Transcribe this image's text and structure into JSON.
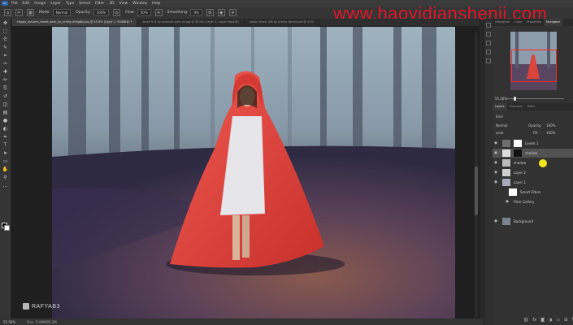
{
  "app": {
    "icon_label": "Ps"
  },
  "menubar": {
    "items": [
      "File",
      "Edit",
      "Image",
      "Layer",
      "Type",
      "Select",
      "Filter",
      "3D",
      "View",
      "Window",
      "Help"
    ]
  },
  "options": {
    "mode_label": "Mode:",
    "mode_value": "Normal",
    "opacity_label": "Opacity:",
    "opacity_value": "100%",
    "flow_label": "Flow:",
    "flow_value": "50%",
    "smoothing_label": "Smoothing:",
    "smoothing_value": "0%"
  },
  "watermark": "www.haoyidianshenji.com",
  "doc_tabs": [
    {
      "label": "Happy_autumn_forest_dark_by_schiko-d9ag6jk.jpg @ 55.6% (Layer 2, RGB/8#) *"
    },
    {
      "label": "stock 911 by aroundit-dark-rb.jpg @ 36.9% (Layer 1, Layer Mask/8)"
    },
    {
      "label": "adobe stock 108 by schiko_forest.psd @ 25%"
    }
  ],
  "tools": [
    "move-tool",
    "marquee-tool",
    "lasso-tool",
    "quick-select-tool",
    "crop-tool",
    "eyedropper-tool",
    "healing-tool",
    "brush-tool",
    "clone-stamp-tool",
    "history-brush-tool",
    "eraser-tool",
    "gradient-tool",
    "blur-tool",
    "dodge-tool",
    "pen-tool",
    "type-tool",
    "path-select-tool",
    "rectangle-tool",
    "hand-tool",
    "zoom-tool",
    "edit-toolbar-tool"
  ],
  "tool_glyphs": [
    "✥",
    "⬚",
    "ᘓ",
    "✎",
    "⌗",
    "✑",
    "✚",
    "✏",
    "⎘",
    "↺",
    "◫",
    "▤",
    "●",
    "◐",
    "✒",
    "T",
    "➤",
    "▭",
    "✋",
    "⚲",
    "…"
  ],
  "navigator": {
    "tabs": [
      "Histogram",
      "Color",
      "Properties",
      "Navigator"
    ],
    "active_tab": "Navigator",
    "zoom": "55.56%"
  },
  "layers": {
    "tabs": [
      "Layers",
      "Channels",
      "Paths"
    ],
    "active_tab": "Layers",
    "kind_label": "Kind",
    "blend_mode": "Normal",
    "opacity_label": "Opacity:",
    "opacity_value": "100%",
    "lock_label": "Lock:",
    "fill_label": "Fill:",
    "fill_value": "100%",
    "items": [
      {
        "name": "Levels 1",
        "kind": "adjustment"
      },
      {
        "name": "shadow",
        "kind": "group"
      },
      {
        "name": "shadow",
        "kind": "layer"
      },
      {
        "name": "Layer 2",
        "kind": "layer"
      },
      {
        "name": "Layer 1",
        "kind": "layer"
      },
      {
        "name": "Smart Filters",
        "kind": "filter"
      },
      {
        "name": "Filter Gallery",
        "kind": "filter"
      },
      {
        "name": "Background",
        "kind": "layer"
      }
    ],
    "bottom_icons": [
      "link-icon",
      "fx-icon",
      "mask-icon",
      "adjustment-icon",
      "folder-icon",
      "new-layer-icon",
      "trash-icon"
    ]
  },
  "status": {
    "zoom": "55.56%",
    "doc_info": "Doc: 5.49M/85.2M"
  },
  "watermark_brand": "RAFYAB3"
}
